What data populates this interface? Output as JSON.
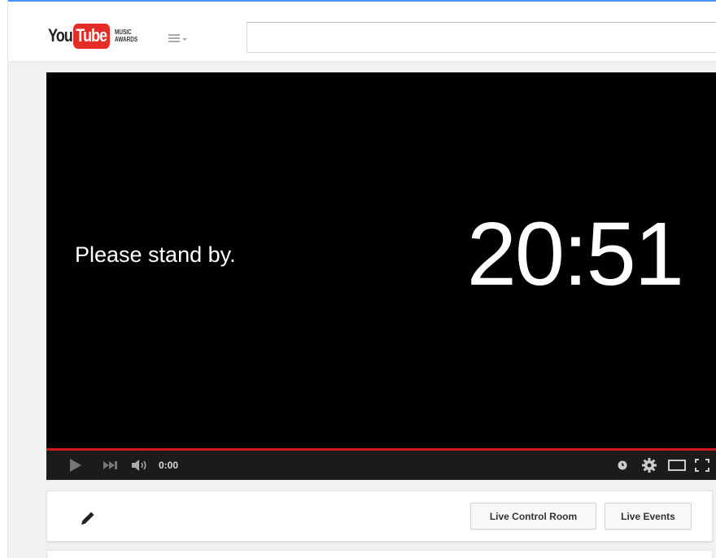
{
  "header": {
    "logo_you": "You",
    "logo_tube": "Tube",
    "logo_sub_line1": "MUSIC",
    "logo_sub_line2": "AWARDS",
    "guide_icon": "hamburger-menu-icon",
    "search_value": "",
    "search_placeholder": ""
  },
  "player": {
    "standby_text": "Please stand by.",
    "countdown": "20:51",
    "current_time": "0:00",
    "progress_color": "#cc181e",
    "icons": {
      "play": "play-icon",
      "next": "next-icon",
      "volume": "volume-icon",
      "clock": "clock-icon",
      "settings": "gear-icon",
      "theater": "theater-mode-icon",
      "fullscreen": "fullscreen-icon"
    }
  },
  "actions": {
    "edit_icon": "pencil-icon",
    "live_control_room_label": "Live Control Room",
    "live_events_label": "Live Events"
  },
  "colors": {
    "brand_red": "#e52d27",
    "header_accent": "#4d90fe",
    "player_bg": "#000000",
    "control_bg": "#1b1b1b"
  }
}
